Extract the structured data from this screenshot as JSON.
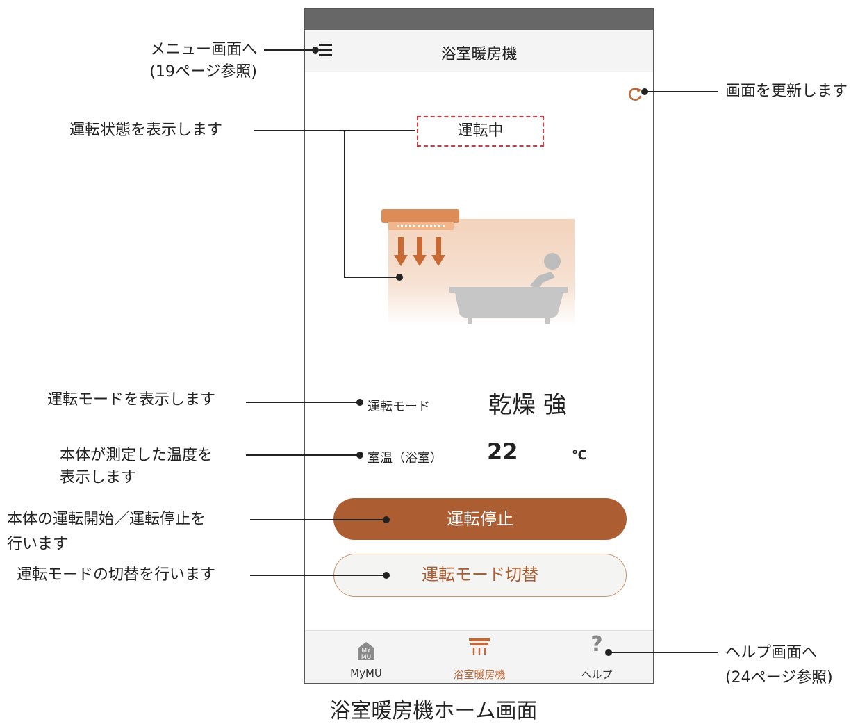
{
  "phone": {
    "header": {
      "title": "浴室暖房機"
    },
    "status": {
      "text": "運転中"
    },
    "info": {
      "mode_label": "運転モード",
      "mode_value": "乾燥 強",
      "temp_label": "室温（浴室）",
      "temp_value": "22",
      "temp_unit": "℃"
    },
    "buttons": {
      "stop_label": "運転停止",
      "mode_label": "運転モード切替"
    },
    "tabbar": {
      "items": [
        {
          "label": "MyMU",
          "icon": "mymu-icon",
          "icon_text_top": "MY",
          "icon_text_bottom": "MU"
        },
        {
          "label": "浴室暖房機",
          "icon": "bath-heater-icon"
        },
        {
          "label": "ヘルプ",
          "icon": "help-icon",
          "icon_text": "?"
        }
      ]
    }
  },
  "callouts": {
    "menu": [
      "メニュー画面へ",
      "(19ページ参照)"
    ],
    "refresh": "画面を更新します",
    "status": "運転状態を表示します",
    "mode": "運転モードを表示します",
    "temp": [
      "本体が測定した温度を",
      "表示します"
    ],
    "start_stop": [
      "本体の運転開始／運転停止を",
      "行います"
    ],
    "mode_switch": "運転モードの切替を行います",
    "help": [
      "ヘルプ画面へ",
      "(24ページ参照)"
    ]
  },
  "caption": "浴室暖房機ホーム画面",
  "colors": {
    "accent": "#ad5d32",
    "status_border": "#d9353a",
    "statusbar": "#676767"
  }
}
